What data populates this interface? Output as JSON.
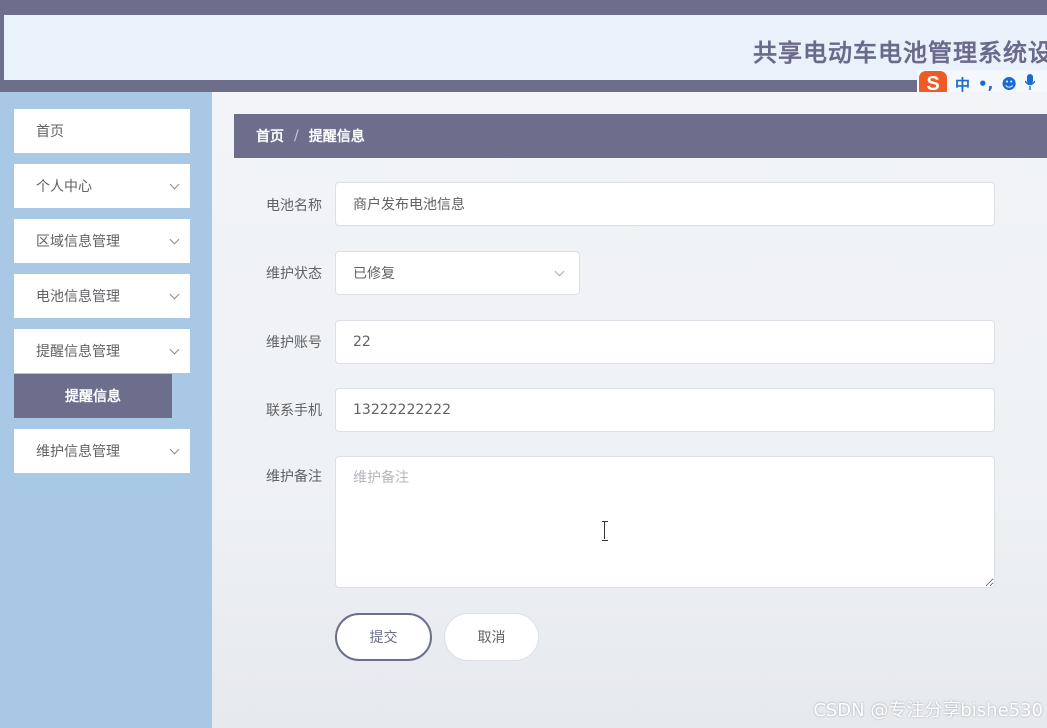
{
  "header": {
    "title": "共享电动车电池管理系统设"
  },
  "ime": {
    "logo": "S",
    "lang": "中",
    "punct": "•,",
    "emoji": "☻",
    "mic": "🎤"
  },
  "sidebar": {
    "items": [
      {
        "label": "首页"
      },
      {
        "label": "个人中心"
      },
      {
        "label": "区域信息管理"
      },
      {
        "label": "电池信息管理"
      },
      {
        "label": "提醒信息管理"
      },
      {
        "label": "维护信息管理"
      }
    ],
    "active_sub": "提醒信息"
  },
  "breadcrumb": {
    "home": "首页",
    "separator": "/",
    "current": "提醒信息"
  },
  "form": {
    "battery_name": {
      "label": "电池名称",
      "value": "商户发布电池信息"
    },
    "maintenance_status": {
      "label": "维护状态",
      "value": "已修复"
    },
    "maintenance_account": {
      "label": "维护账号",
      "value": "22"
    },
    "phone": {
      "label": "联系手机",
      "value": "13222222222"
    },
    "remark": {
      "label": "维护备注",
      "placeholder": "维护备注"
    }
  },
  "buttons": {
    "submit": "提交",
    "cancel": "取消"
  },
  "watermark": "CSDN @专注分享bishe530"
}
